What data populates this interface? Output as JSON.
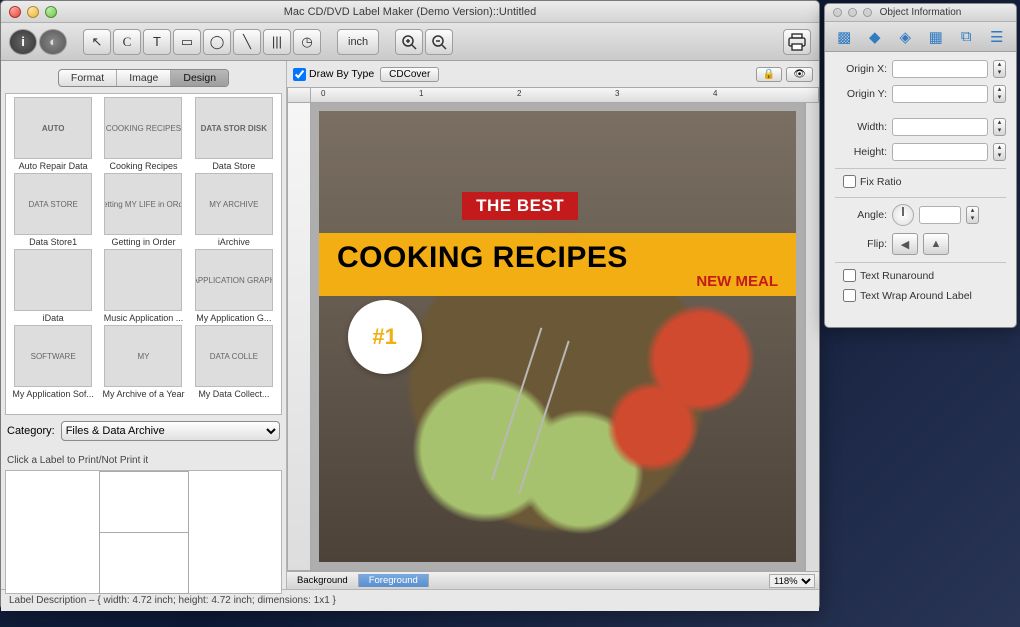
{
  "main_window": {
    "title": "Mac CD/DVD Label Maker (Demo Version)::Untitled",
    "toolbar": {
      "info_icon": "i",
      "mask_icon": "◐",
      "pointer_icon": "↖",
      "circle_icon": "◯",
      "text_icon": "T",
      "rect_icon": "▭",
      "ellipse_icon": "◯",
      "line_icon": "╲",
      "barcode_icon": "|||",
      "dial_icon": "◷",
      "inch_label": "inch",
      "zoomin_icon": "⊕",
      "zoomout_icon": "⊖",
      "print_icon": "🖨"
    },
    "sidebar": {
      "tabs": {
        "format": "Format",
        "image": "Image",
        "design": "Design"
      },
      "templates": [
        {
          "name": "Auto Repair Data",
          "css": "th-auto",
          "text": "AUTO"
        },
        {
          "name": "Cooking Recipes",
          "css": "th-cook",
          "text": "COOKING RECIPES"
        },
        {
          "name": "Data Store",
          "css": "th-data",
          "text": "DATA STOR DISK"
        },
        {
          "name": "Data Store1",
          "css": "th-data1",
          "text": "DATA STORE"
        },
        {
          "name": "Getting in Order",
          "css": "th-order",
          "text": "Getting MY LIFE in ORder"
        },
        {
          "name": "iArchive",
          "css": "th-iarch",
          "text": "MY ARCHIVE"
        },
        {
          "name": "iData",
          "css": "th-idata",
          "text": ""
        },
        {
          "name": "Music Application ...",
          "css": "th-music",
          "text": ""
        },
        {
          "name": "My Application G...",
          "css": "th-myapp",
          "text": "MY APPLICATION GRAPHICS"
        },
        {
          "name": "My Application Sof...",
          "css": "th-soft",
          "text": "SOFTWARE"
        },
        {
          "name": "My Archive of a Year",
          "css": "th-year",
          "text": "MY"
        },
        {
          "name": "My Data Collect...",
          "css": "th-collect",
          "text": "DATA COLLE"
        }
      ],
      "category_label": "Category:",
      "category_value": "Files & Data Archive",
      "print_hint": "Click a Label to Print/Not Print it"
    },
    "canvas": {
      "draw_by_type_label": "Draw By Type",
      "cdcover_label": "CDCover",
      "lock_icon": "🔒",
      "eye_icon": "👁",
      "ruler_marks": [
        "0",
        "1",
        "2",
        "3",
        "4"
      ],
      "label_art": {
        "red_band": "THE BEST",
        "headline": "COOKING RECIPES",
        "subhead": "NEW MEAL",
        "badge": "#1"
      },
      "bottom_tabs": {
        "background": "Background",
        "foreground": "Foreground"
      },
      "zoom_value": "118%"
    },
    "status_bar": "Label Description – { width: 4.72 inch; height: 4.72 inch; dimensions: 1x1 }"
  },
  "inspector": {
    "title": "Object Information",
    "toolbar_icons": [
      "cube-icon",
      "extrude-icon",
      "shape-icon",
      "fill-icon",
      "distribute-icon",
      "layers-icon"
    ],
    "fields": {
      "origin_x": "Origin X:",
      "origin_y": "Origin Y:",
      "width": "Width:",
      "height": "Height:",
      "fix_ratio": "Fix Ratio",
      "angle": "Angle:",
      "flip": "Flip:",
      "text_runaround": "Text Runaround",
      "text_wrap": "Text Wrap Around Label"
    }
  }
}
